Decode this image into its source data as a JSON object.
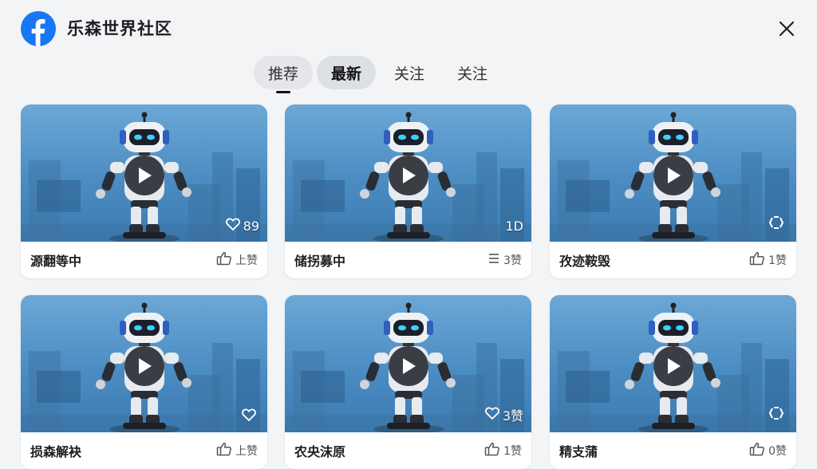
{
  "header": {
    "title": "乐森世界社区",
    "logo_icon": "facebook-logo-icon",
    "close_icon": "close-icon",
    "brand_color": "#1877f2"
  },
  "tabs": [
    {
      "label": "推荐",
      "style": "pill",
      "selected": true
    },
    {
      "label": "最新",
      "style": "active-dark",
      "selected": false
    },
    {
      "label": "关注",
      "style": "plain",
      "selected": false
    },
    {
      "label": "关注",
      "style": "plain",
      "selected": false
    }
  ],
  "cards": [
    {
      "title": "源翻等中",
      "badge_icon": "heart-icon",
      "badge_text": "89",
      "like_icon": "thumbs-up-icon",
      "like_text": "上赞"
    },
    {
      "title": "储拐募中",
      "badge_icon": "",
      "badge_text": "1D",
      "like_icon": "menu-lines-icon",
      "like_text": "3赞"
    },
    {
      "title": "孜迹鞍毁",
      "badge_icon": "refresh-icon",
      "badge_text": "",
      "like_icon": "thumbs-up-icon",
      "like_text": "1赞"
    },
    {
      "title": "损森解袂",
      "badge_icon": "heart-icon",
      "badge_text": "",
      "like_icon": "thumbs-up-icon",
      "like_text": "上赞"
    },
    {
      "title": "农央沫原",
      "badge_icon": "heart-icon",
      "badge_text": "3赞",
      "like_icon": "thumbs-up-icon",
      "like_text": "1赞"
    },
    {
      "title": "精支蒲",
      "badge_icon": "refresh-icon",
      "badge_text": "",
      "like_icon": "thumbs-up-icon",
      "like_text": "0赞"
    }
  ]
}
